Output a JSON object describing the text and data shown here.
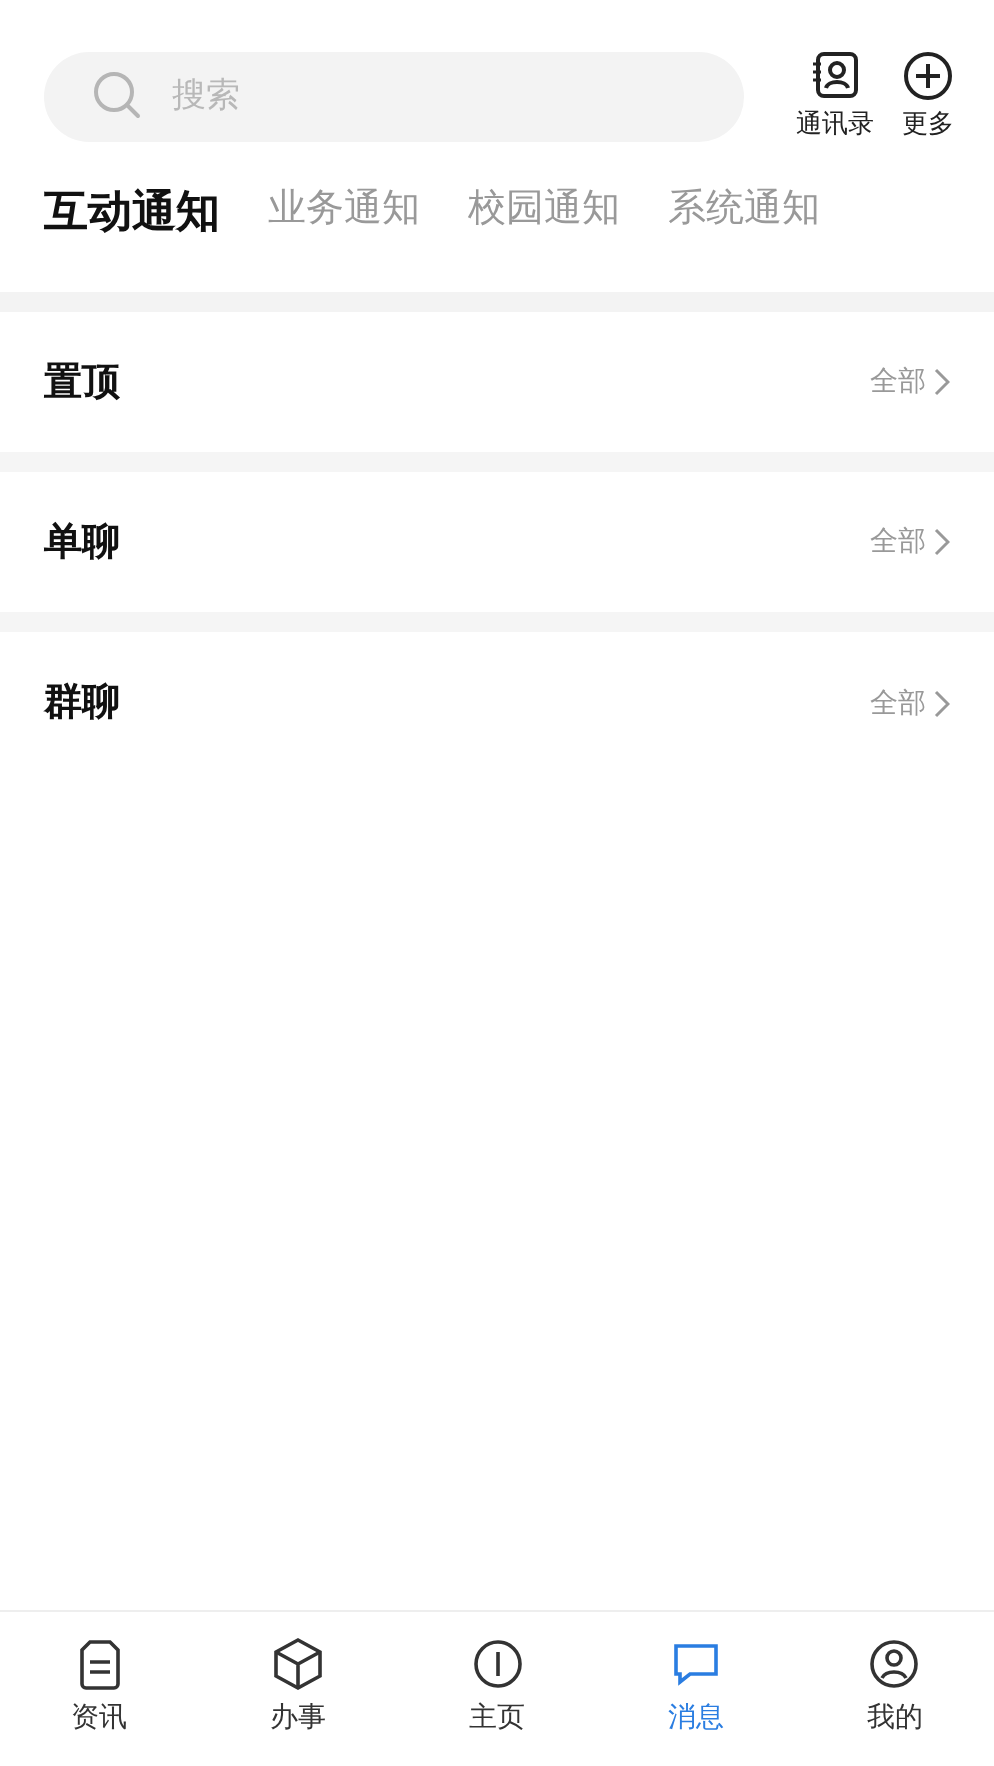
{
  "search": {
    "placeholder": "搜索"
  },
  "header_actions": [
    {
      "kind": "contacts",
      "label": "通讯录"
    },
    {
      "kind": "more",
      "label": "更多"
    }
  ],
  "tabs": [
    {
      "label": "互动通知",
      "selected": true
    },
    {
      "label": "业务通知",
      "selected": false
    },
    {
      "label": "校园通知",
      "selected": false
    },
    {
      "label": "系统通知",
      "selected": false
    }
  ],
  "sections": [
    {
      "title": "置顶",
      "link": "全部"
    },
    {
      "title": "单聊",
      "link": "全部"
    },
    {
      "title": "群聊",
      "link": "全部"
    }
  ],
  "bottom_nav": [
    {
      "kind": "news",
      "label": "资讯",
      "selected": false
    },
    {
      "kind": "tasks",
      "label": "办事",
      "selected": false
    },
    {
      "kind": "home",
      "label": "主页",
      "selected": false
    },
    {
      "kind": "messages",
      "label": "消息",
      "selected": true
    },
    {
      "kind": "profile",
      "label": "我的",
      "selected": false
    }
  ]
}
